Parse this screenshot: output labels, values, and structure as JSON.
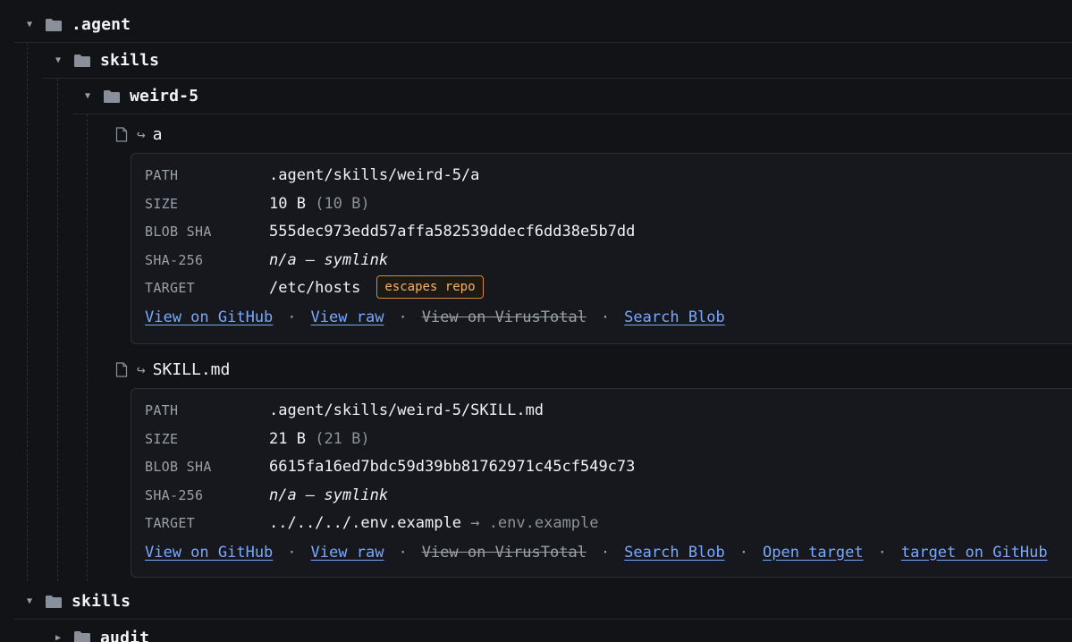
{
  "tree": {
    "agent_folder": {
      "name": ".agent"
    },
    "skills_folder": {
      "name": "skills"
    },
    "weird_folder": {
      "name": "weird-5"
    },
    "file_a": {
      "arrow": "↪",
      "name": "a",
      "details": {
        "path_label": "PATH",
        "path": ".agent/skills/weird-5/a",
        "size_label": "SIZE",
        "size": "10 B",
        "size_exact": "(10 B)",
        "blob_label": "BLOB SHA",
        "blob_sha": "555dec973edd57affa582539ddecf6dd38e5b7dd",
        "sha256_label": "SHA-256",
        "sha256": "n/a — symlink",
        "target_label": "TARGET",
        "target": "/etc/hosts",
        "badge": "escapes repo"
      },
      "links": [
        "View on GitHub",
        "View raw",
        "View on VirusTotal",
        "Search Blob"
      ]
    },
    "file_skill": {
      "arrow": "↪",
      "name": "SKILL.md",
      "details": {
        "path_label": "PATH",
        "path": ".agent/skills/weird-5/SKILL.md",
        "size_label": "SIZE",
        "size": "21 B",
        "size_exact": "(21 B)",
        "blob_label": "BLOB SHA",
        "blob_sha": "6615fa16ed7bdc59d39bb81762971c45cf549c73",
        "sha256_label": "SHA-256",
        "sha256": "n/a — symlink",
        "target_label": "TARGET",
        "target": "../../../.env.example",
        "target_arrow": "→",
        "target_resolved": ".env.example"
      },
      "links": [
        "View on GitHub",
        "View raw",
        "View on VirusTotal",
        "Search Blob",
        "Open target",
        "target on GitHub"
      ]
    },
    "root_skills_folder": {
      "name": "skills"
    },
    "audit_folder": {
      "name": "audit"
    }
  },
  "separator": "·"
}
